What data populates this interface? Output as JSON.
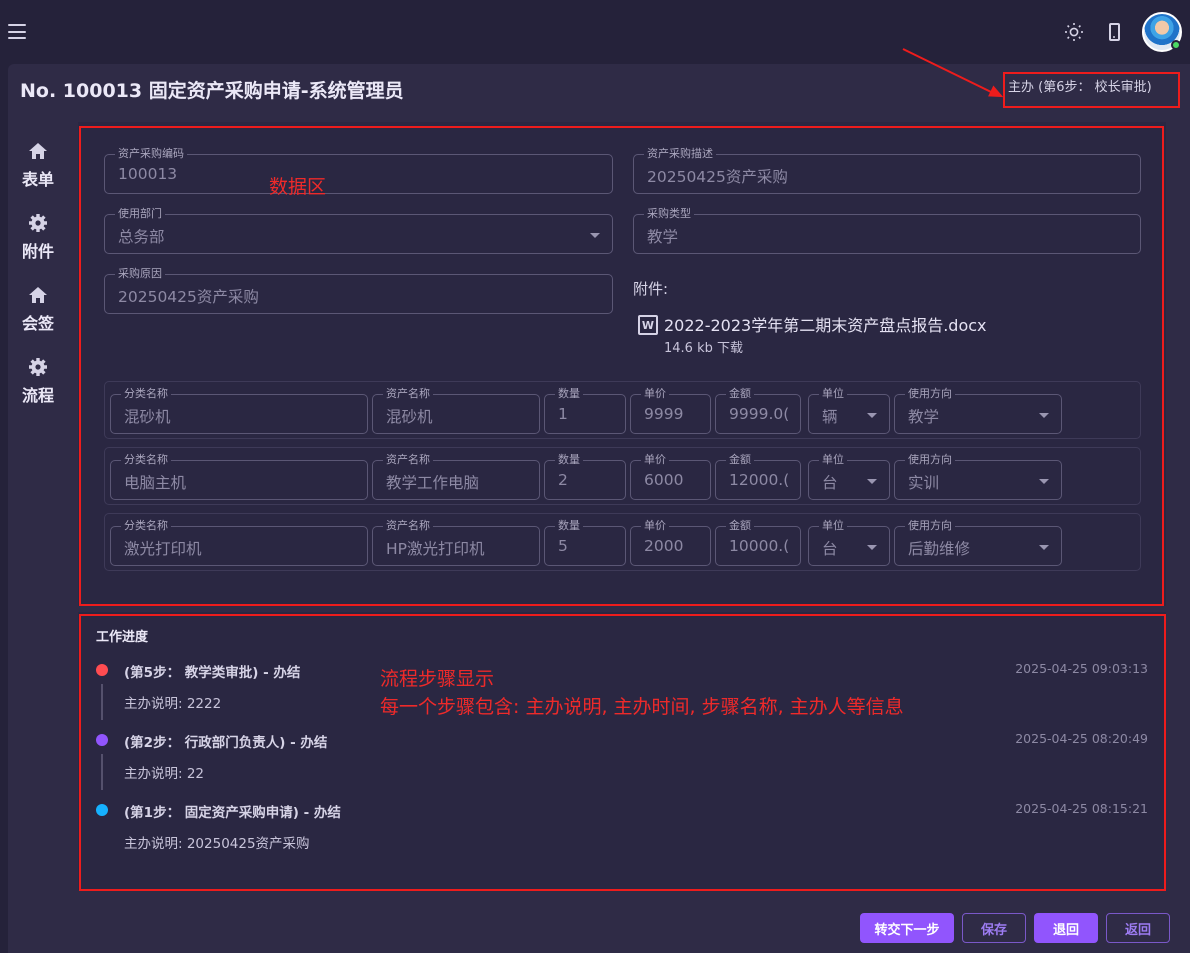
{
  "header": {
    "menu_icon": "hamburger-menu-icon",
    "theme_icon": "sun-icon",
    "device_icon": "mobile-phone-icon",
    "avatar_status_color": "#4cd964"
  },
  "page": {
    "title": "No. 100013 固定资产采购申请-系统管理员",
    "status": "主办 (第6步： 校长审批)"
  },
  "nav": [
    {
      "label": "表单",
      "icon": "home-icon"
    },
    {
      "label": "附件",
      "icon": "gear-icon"
    },
    {
      "label": "会签",
      "icon": "home-icon"
    },
    {
      "label": "流程",
      "icon": "gear-icon"
    }
  ],
  "annotations": {
    "data_area": "数据区",
    "flow_line1": "流程步骤显示",
    "flow_line2": "每一个步骤包含: 主办说明, 主办时间, 步骤名称, 主办人等信息"
  },
  "form": {
    "code": {
      "label": "资产采购编码",
      "value": "100013"
    },
    "desc": {
      "label": "资产采购描述",
      "value": "20250425资产采购"
    },
    "dept": {
      "label": "使用部门",
      "value": "总务部"
    },
    "type": {
      "label": "采购类型",
      "value": "教学"
    },
    "reason": {
      "label": "采购原因",
      "value": "20250425资产采购"
    },
    "attachment_label": "附件:",
    "attachment": {
      "icon": "word-document-icon",
      "icon_text": "W",
      "name": "2022-2023学年第二期末资产盘点报告.docx",
      "meta": "14.6 kb 下载"
    }
  },
  "item_labels": {
    "category": "分类名称",
    "name": "资产名称",
    "qty": "数量",
    "price": "单价",
    "amount": "金额",
    "unit": "单位",
    "usage": "使用方向"
  },
  "items": [
    {
      "category": "混砂机",
      "name": "混砂机",
      "qty": "1",
      "price": "9999",
      "amount": "9999.0(",
      "unit": "辆",
      "usage": "教学"
    },
    {
      "category": "电脑主机",
      "name": "教学工作电脑",
      "qty": "2",
      "price": "6000",
      "amount": "12000.(",
      "unit": "台",
      "usage": "实训"
    },
    {
      "category": "激光打印机",
      "name": "HP激光打印机",
      "qty": "5",
      "price": "2000",
      "amount": "10000.(",
      "unit": "台",
      "usage": "后勤维修"
    }
  ],
  "progress": {
    "title": "工作进度",
    "steps": [
      {
        "title": "(第5步： 教学类审批) - 办结",
        "note": "主办说明: 2222",
        "time": "2025-04-25 09:03:13",
        "color": "#ff4c51"
      },
      {
        "title": "(第2步： 行政部门负责人) - 办结",
        "note": "主办说明: 22",
        "time": "2025-04-25 08:20:49",
        "color": "#9155fd"
      },
      {
        "title": "(第1步： 固定资产采购申请) - 办结",
        "note": "主办说明: 20250425资产采购",
        "time": "2025-04-25 08:15:21",
        "color": "#16b1ff"
      }
    ]
  },
  "actions": {
    "next": "转交下一步",
    "save": "保存",
    "reject": "退回",
    "back": "返回"
  }
}
